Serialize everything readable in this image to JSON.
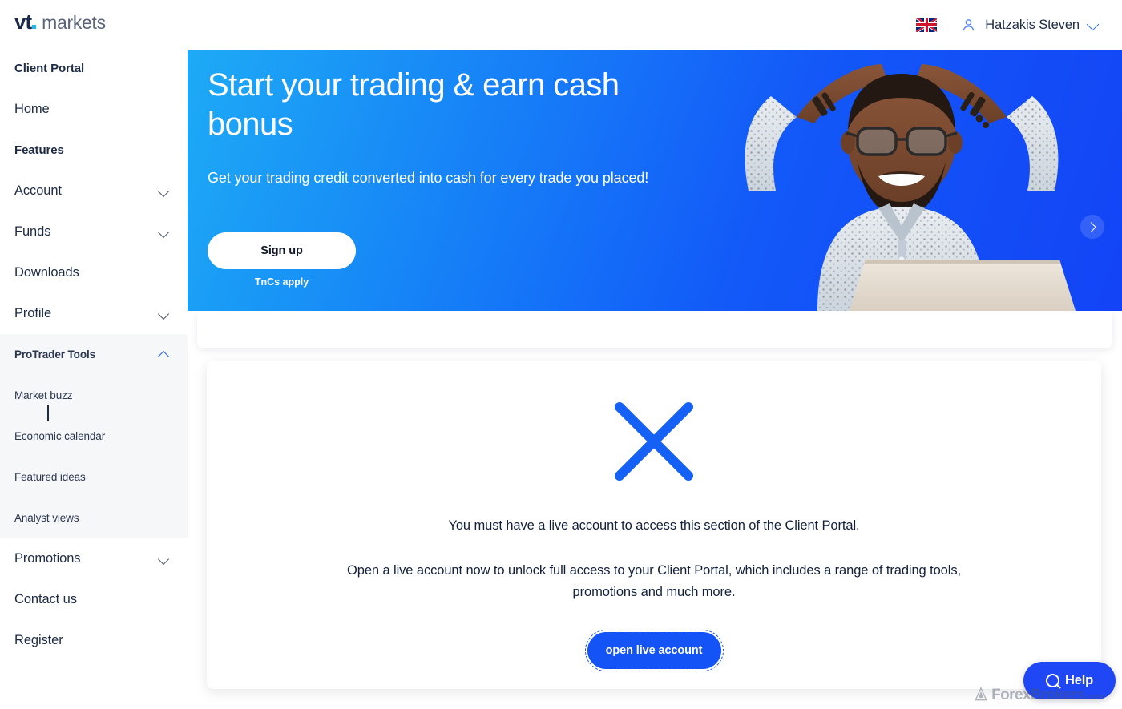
{
  "brand": {
    "logo_primary": "vt",
    "logo_secondary": "markets",
    "accent_color": "#1453f5",
    "logo_dot_color": "#19b9f0"
  },
  "header": {
    "language_flag": "uk-flag-icon",
    "user_icon": "person-icon",
    "user_name": "Hatzakis Steven",
    "user_menu_chevron": "chevron-down-icon"
  },
  "sidebar": {
    "items": [
      {
        "label": "Client Portal",
        "type": "section",
        "expandable": false
      },
      {
        "label": "Home",
        "type": "link",
        "expandable": false
      },
      {
        "label": "Features",
        "type": "section",
        "expandable": false
      },
      {
        "label": "Account",
        "type": "link",
        "expandable": true,
        "expanded": false
      },
      {
        "label": "Funds",
        "type": "link",
        "expandable": true,
        "expanded": false
      },
      {
        "label": "Downloads",
        "type": "link",
        "expandable": false
      },
      {
        "label": "Profile",
        "type": "link",
        "expandable": true,
        "expanded": false
      },
      {
        "label": "ProTrader Tools",
        "type": "link",
        "expandable": true,
        "expanded": true
      },
      {
        "label": "Promotions",
        "type": "link",
        "expandable": true,
        "expanded": false
      },
      {
        "label": "Contact us",
        "type": "link",
        "expandable": false
      },
      {
        "label": "Register",
        "type": "link",
        "expandable": false
      }
    ],
    "protrader_subitems": [
      {
        "label": "Market buzz"
      },
      {
        "label": "Economic calendar"
      },
      {
        "label": "Featured ideas"
      },
      {
        "label": "Analyst views"
      }
    ]
  },
  "banner": {
    "headline": "Start your trading & earn cash bonus",
    "subtext": "Get your trading credit converted into cash for every trade you placed!",
    "cta_label": "Sign up",
    "terms_label": "TnCs apply",
    "next_arrow": "chevron-right-icon",
    "hero_image": "smiling-man-with-laptop-photo",
    "background_color": "#1358f8"
  },
  "main": {
    "status_icon": "x-cross-icon",
    "status_icon_color": "#1561f5",
    "message_primary": "You must have a live account to access this section of the Client Portal.",
    "message_secondary": "Open a live account now to unlock full access to your Client Portal, which includes a range of trading tools, promotions and much more.",
    "cta_label": "open live account"
  },
  "help_widget": {
    "label": "Help",
    "icon": "help-circle-icon",
    "color": "#1f47f5"
  },
  "watermark": {
    "icon": "forexbrokers-logo-icon",
    "text_main": "ForexBrokers",
    "text_suffix": ".com"
  }
}
